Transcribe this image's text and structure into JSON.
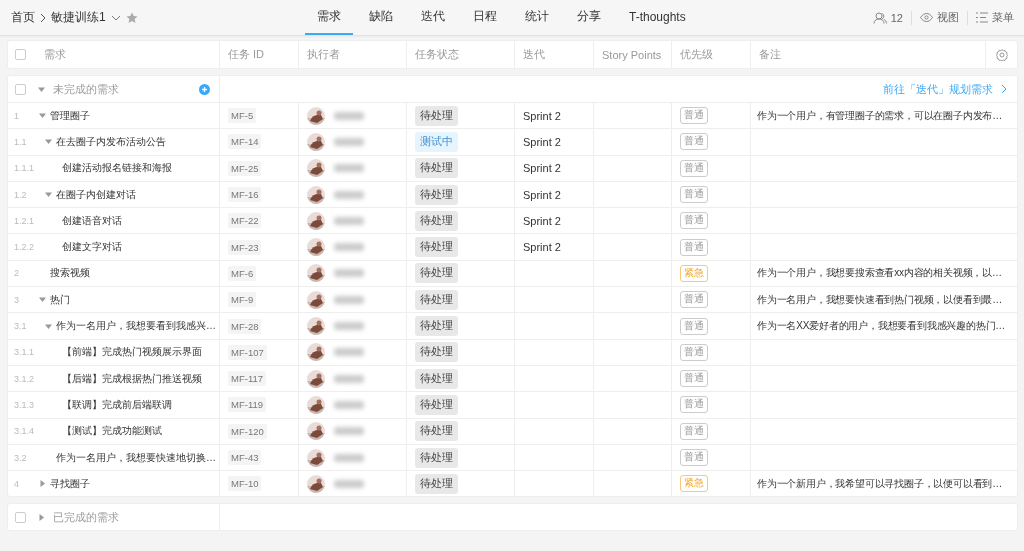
{
  "breadcrumb": {
    "home": "首页",
    "project": "敏捷训练1",
    "starred": false
  },
  "tabs": [
    {
      "label": "需求",
      "selected": true
    },
    {
      "label": "缺陷",
      "selected": false
    },
    {
      "label": "迭代",
      "selected": false
    },
    {
      "label": "日程",
      "selected": false
    },
    {
      "label": "统计",
      "selected": false
    },
    {
      "label": "分享",
      "selected": false
    },
    {
      "label": "T-thoughts",
      "selected": false
    }
  ],
  "toolbar": {
    "members": "12",
    "view": "视图",
    "menu": "菜单"
  },
  "table": {
    "select_all": {
      "checked": false
    },
    "columns": [
      "需求",
      "任务 ID",
      "执行者",
      "任务状态",
      "迭代",
      "Story Points",
      "优先级",
      "备注"
    ],
    "open_group": {
      "label": "未完成的需求",
      "expanded": true,
      "checked": false,
      "link": "前往「迭代」规划需求"
    },
    "rows": [
      {
        "number": "1",
        "title": "管理圈子",
        "id": "MF-5",
        "status": {
          "text": "待处理",
          "kind": "todo"
        },
        "iteration": "Sprint 2",
        "priority": {
          "text": "普通",
          "kind": "normal"
        },
        "note": "作为一个用户，有管理圈子的需求，可以在圈子内发布…",
        "expanded": true,
        "children": [
          {
            "number": "1.1",
            "title": "在去圈子内发布活动公告",
            "id": "MF-14",
            "status": {
              "text": "测试中",
              "kind": "testing"
            },
            "iteration": "Sprint 2",
            "priority": {
              "text": "普通",
              "kind": "normal"
            },
            "expanded": true,
            "children": [
              {
                "number": "1.1.1",
                "title": "创建活动报名链接和海报",
                "id": "MF-25",
                "status": {
                  "text": "待处理",
                  "kind": "todo"
                },
                "iteration": "Sprint 2",
                "priority": {
                  "text": "普通",
                  "kind": "normal"
                }
              }
            ]
          },
          {
            "number": "1.2",
            "title": "在圈子内创建对话",
            "id": "MF-16",
            "status": {
              "text": "待处理",
              "kind": "todo"
            },
            "iteration": "Sprint 2",
            "priority": {
              "text": "普通",
              "kind": "normal"
            },
            "expanded": true,
            "children": [
              {
                "number": "1.2.1",
                "title": "创建语音对话",
                "id": "MF-22",
                "status": {
                  "text": "待处理",
                  "kind": "todo"
                },
                "iteration": "Sprint 2",
                "priority": {
                  "text": "普通",
                  "kind": "normal"
                }
              },
              {
                "number": "1.2.2",
                "title": "创建文字对话",
                "id": "MF-23",
                "status": {
                  "text": "待处理",
                  "kind": "todo"
                },
                "iteration": "Sprint 2",
                "priority": {
                  "text": "普通",
                  "kind": "normal"
                }
              }
            ]
          }
        ]
      },
      {
        "number": "2",
        "title": "搜索视频",
        "id": "MF-6",
        "status": {
          "text": "待处理",
          "kind": "todo"
        },
        "priority": {
          "text": "紧急",
          "kind": "urgent"
        },
        "note": "作为一个用户，我想要搜索查看xx内容的相关视频，以…"
      },
      {
        "number": "3",
        "title": "热门",
        "id": "MF-9",
        "status": {
          "text": "待处理",
          "kind": "todo"
        },
        "priority": {
          "text": "普通",
          "kind": "normal"
        },
        "note": "作为一名用户，我想要快速看到热门视频，以便看到最…",
        "expanded": true,
        "children": [
          {
            "number": "3.1",
            "title": "作为一名用户，我想要看到我感兴…",
            "id": "MF-28",
            "status": {
              "text": "待处理",
              "kind": "todo"
            },
            "priority": {
              "text": "普通",
              "kind": "normal"
            },
            "note": "作为一名XX爱好者的用户，我想要看到我感兴趣的热门…",
            "expanded": true,
            "children": [
              {
                "number": "3.1.1",
                "title": "【前端】完成热门视频展示界面",
                "id": "MF-107",
                "status": {
                  "text": "待处理",
                  "kind": "todo"
                },
                "priority": {
                  "text": "普通",
                  "kind": "normal"
                }
              },
              {
                "number": "3.1.2",
                "title": "【后端】完成根据热门推送视频",
                "id": "MF-117",
                "status": {
                  "text": "待处理",
                  "kind": "todo"
                },
                "priority": {
                  "text": "普通",
                  "kind": "normal"
                }
              },
              {
                "number": "3.1.3",
                "title": "【联调】完成前后端联调",
                "id": "MF-119",
                "status": {
                  "text": "待处理",
                  "kind": "todo"
                },
                "priority": {
                  "text": "普通",
                  "kind": "normal"
                }
              },
              {
                "number": "3.1.4",
                "title": "【测试】完成功能测试",
                "id": "MF-120",
                "status": {
                  "text": "待处理",
                  "kind": "todo"
                },
                "priority": {
                  "text": "普通",
                  "kind": "normal"
                }
              }
            ]
          },
          {
            "number": "3.2",
            "title": "作为一名用户，我想要快速地切换…",
            "id": "MF-43",
            "status": {
              "text": "待处理",
              "kind": "todo"
            },
            "priority": {
              "text": "普通",
              "kind": "normal"
            }
          }
        ]
      },
      {
        "number": "4",
        "title": "寻找圈子",
        "id": "MF-10",
        "status": {
          "text": "待处理",
          "kind": "todo"
        },
        "priority": {
          "text": "紧急",
          "kind": "urgent"
        },
        "note": "作为一个新用户，我希望可以寻找圈子，以便可以看到…",
        "expanded": false
      }
    ],
    "done_group": {
      "label": "已完成的需求",
      "expanded": false,
      "checked": false
    }
  }
}
